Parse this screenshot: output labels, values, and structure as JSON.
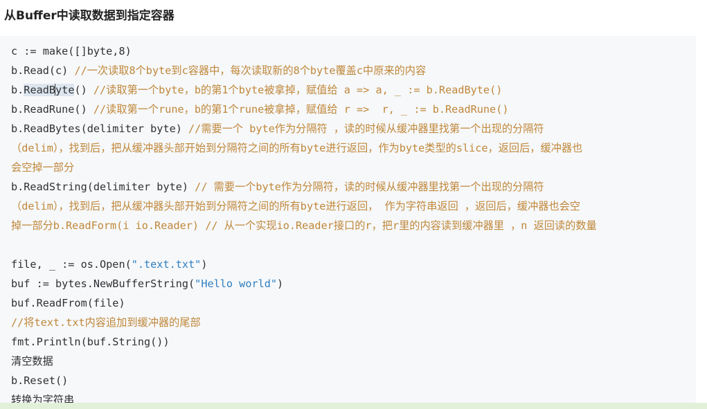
{
  "heading": "从Buffer中读取数据到指定容器",
  "code": {
    "l1": "c := make([]byte,8)",
    "l2_code": "b.Read(c) ",
    "l2_comment": "//一次读取8个byte到c容器中，每次读取新的8个byte覆盖c中原来的内容",
    "l3_pre": "b.",
    "l3_hl_a": "ReadB",
    "l3_hl_b": "y",
    "l3_hl_c": "te",
    "l3_code": "() ",
    "l3_comment": "//读取第一个byte，b的第1个byte被拿掉，赋值给 a => a, _ := b.ReadByte()",
    "l4_code": "b.ReadRune() ",
    "l4_comment": "//读取第一个rune，b的第1个rune被拿掉，赋值给 r =>  r, _ := b.ReadRune()",
    "l5_code": "b.ReadBytes(delimiter byte) ",
    "l5_comment": "//需要一个 byte作为分隔符 ，读的时候从缓冲器里找第一个出现的分隔符",
    "l6_comment": "（delim），找到后，把从缓冲器头部开始到分隔符之间的所有byte进行返回，作为byte类型的slice，返回后，缓冲器也",
    "l7_comment": "会空掉一部分",
    "l8_code": "b.ReadString(delimiter byte) ",
    "l8_comment": "// 需要一个byte作为分隔符，读的时候从缓冲器里找第一个出现的分隔符",
    "l9_comment": "（delim），找到后，把从缓冲器头部开始到分隔符之间的所有byte进行返回， 作为字符串返回 ，返回后，缓冲器也会空",
    "l10_comment": "掉一部分b.ReadForm(i io.Reader) // 从一个实现io.Reader接口的r，把r里的内容读到缓冲器里 ，n 返回读的数量",
    "l12_code": "file, _ := os.Open(",
    "l12_str": "\".text.txt\"",
    "l12_end": ")",
    "l13_code": "buf := bytes.NewBufferString(",
    "l13_str": "\"Hello world\"",
    "l13_end": ")",
    "l14": "buf.ReadFrom(file)",
    "l15_comment": "//将text.txt内容追加到缓冲器的尾部",
    "l16": "fmt.Println(buf.String())",
    "l17": "清空数据",
    "l18": "b.Reset()",
    "l19": "转换为字符串"
  },
  "colors": {
    "comment": "#c0873a",
    "string": "#2f7fc0",
    "code": "#2f3033",
    "background": "#f6f8fa"
  }
}
